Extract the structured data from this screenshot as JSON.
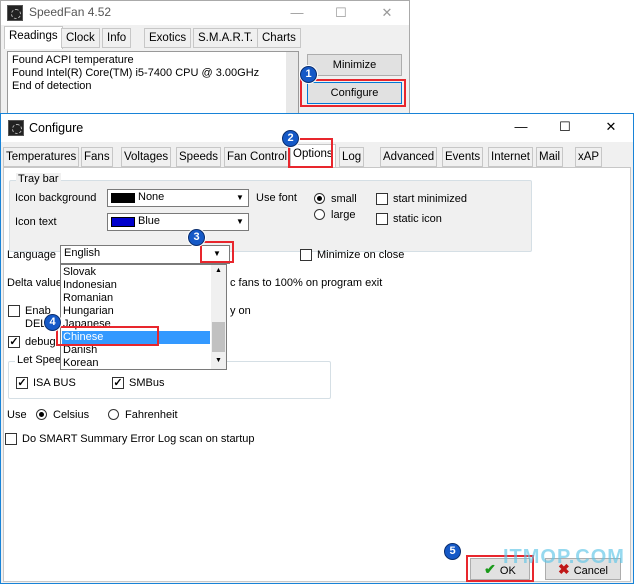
{
  "speedfan": {
    "title": "SpeedFan 4.52",
    "tabs": [
      "Readings",
      "Clock",
      "Info",
      "Exotics",
      "S.M.A.R.T.",
      "Charts"
    ],
    "log_lines": [
      "Found ACPI temperature",
      "Found Intel(R) Core(TM) i5-7400 CPU @ 3.00GHz",
      "End of detection"
    ],
    "minimize_label": "Minimize",
    "configure_label": "Configure"
  },
  "configure": {
    "title": "Configure",
    "tabs": [
      "Temperatures",
      "Fans",
      "Voltages",
      "Speeds",
      "Fan Control",
      "Options",
      "Log",
      "Advanced",
      "Events",
      "Internet",
      "Mail",
      "xAP"
    ],
    "active_tab": "Options",
    "tray_bar": {
      "label": "Tray bar",
      "icon_background_label": "Icon background",
      "icon_background_value": "None",
      "icon_background_color": "#000000",
      "icon_text_label": "Icon text",
      "icon_text_value": "Blue",
      "icon_text_color": "#0000cc",
      "use_font_label": "Use font",
      "small_label": "small",
      "large_label": "large",
      "font_selected": "small",
      "start_minimized_label": "start minimized",
      "static_icon_label": "static icon"
    },
    "language": {
      "label": "Language",
      "value": "English",
      "options": [
        "Slovak",
        "Indonesian",
        "Romanian",
        "Hungarian",
        "Japanese",
        "Chinese",
        "Danish",
        "Korean"
      ],
      "highlighted": "Chinese"
    },
    "minimize_on_close_label": "Minimize on close",
    "delta_value_label_visible": "Delta value",
    "fans_full_label_visible": "c fans to 100% on program exit",
    "enable_label_visible": "Enab",
    "del_label_visible": "DEL",
    "by_on_label_visible": "y on",
    "debug_label_visible": "debug",
    "let_speed": {
      "label_visible": "Let Spee",
      "isa_bus_label": "ISA BUS",
      "smbus_label": "SMBus"
    },
    "use_label": "Use",
    "celsius_label": "Celsius",
    "fahrenheit_label": "Fahrenheit",
    "temp_unit_selected": "Celsius",
    "smart_log_label": "Do SMART Summary Error Log scan on startup",
    "ok_label": "OK",
    "cancel_label": "Cancel"
  },
  "steps": [
    "1",
    "2",
    "3",
    "4",
    "5"
  ],
  "watermark": "ITMOP.COM",
  "colors": {
    "accent_blue": "#1559c7",
    "highlight_red": "#e8262d",
    "selection": "#3399ff"
  }
}
